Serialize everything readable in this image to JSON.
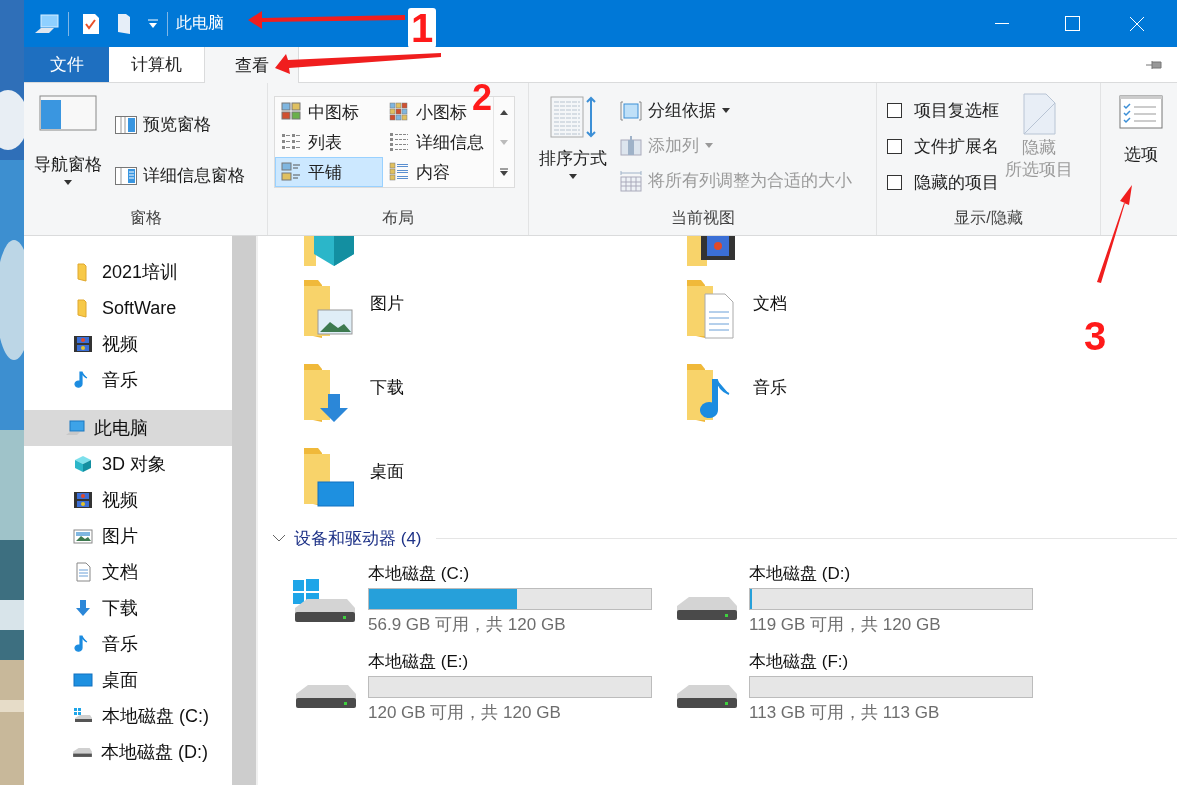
{
  "title_bar": {
    "title": "此电脑"
  },
  "tabs": [
    {
      "label": "文件",
      "kind": "file",
      "selected": false
    },
    {
      "label": "计算机",
      "kind": "tab",
      "selected": false
    },
    {
      "label": "查看",
      "kind": "tab",
      "selected": true
    }
  ],
  "ribbon": {
    "panes": {
      "label": "窗格",
      "nav_pane": "导航窗格",
      "preview_pane": "预览窗格",
      "details_pane": "详细信息窗格"
    },
    "layout": {
      "label": "布局",
      "options": [
        {
          "label": "中图标",
          "kind": "medium",
          "selected": false
        },
        {
          "label": "小图标",
          "kind": "small",
          "selected": false
        },
        {
          "label": "列表",
          "kind": "list",
          "selected": false
        },
        {
          "label": "详细信息",
          "kind": "details",
          "selected": false
        },
        {
          "label": "平铺",
          "kind": "tiles",
          "selected": true
        },
        {
          "label": "内容",
          "kind": "content",
          "selected": false
        }
      ]
    },
    "current_view": {
      "label": "当前视图",
      "sort": "排序方式",
      "commands": [
        {
          "label": "分组依据",
          "kind": "group",
          "dropdown": true,
          "disabled": false
        },
        {
          "label": "添加列",
          "kind": "column",
          "dropdown": true,
          "disabled": true
        },
        {
          "label": "将所有列调整为合适的大小",
          "kind": "fit",
          "dropdown": false,
          "disabled": true
        }
      ]
    },
    "show_hide": {
      "label": "显示/隐藏",
      "checkboxes": [
        {
          "label": "项目复选框",
          "checked": false
        },
        {
          "label": "文件扩展名",
          "checked": false
        },
        {
          "label": "隐藏的项目",
          "checked": false
        }
      ],
      "hide_selected": {
        "lines": [
          "隐藏",
          "所选项目"
        ],
        "disabled": true
      }
    },
    "options": {
      "label": "选项"
    }
  },
  "sidebar": {
    "quick_access": [
      {
        "label": "2021培训",
        "kind": "folder",
        "selected": false
      },
      {
        "label": "SoftWare",
        "kind": "folder",
        "selected": false
      },
      {
        "label": "视频",
        "kind": "video",
        "selected": false
      },
      {
        "label": "音乐",
        "kind": "music",
        "selected": false
      }
    ],
    "this_pc": {
      "label": "此电脑",
      "selected": true,
      "children": [
        {
          "label": "3D 对象",
          "kind": "cube",
          "selected": false
        },
        {
          "label": "视频",
          "kind": "video",
          "selected": false
        },
        {
          "label": "图片",
          "kind": "pictures",
          "selected": false
        },
        {
          "label": "文档",
          "kind": "documents",
          "selected": false
        },
        {
          "label": "下载",
          "kind": "downloads",
          "selected": false
        },
        {
          "label": "音乐",
          "kind": "music",
          "selected": false
        },
        {
          "label": "桌面",
          "kind": "desktop",
          "selected": false
        },
        {
          "label": "本地磁盘 (C:)",
          "kind": "system",
          "selected": false
        },
        {
          "label": "本地磁盘 (D:)",
          "kind": "drive",
          "selected": false
        }
      ]
    }
  },
  "folders": [
    {
      "label": "图片",
      "kind": "pictures"
    },
    {
      "label": "文档",
      "kind": "documents"
    },
    {
      "label": "下载",
      "kind": "downloads"
    },
    {
      "label": "音乐",
      "kind": "music"
    },
    {
      "label": "桌面",
      "kind": "desktop"
    }
  ],
  "devices": {
    "header": "设备和驱动器 (4)",
    "expanded": true,
    "drives": [
      {
        "name": "本地磁盘 (C:)",
        "kind": "system",
        "level": 0.526,
        "free": "56.9 GB 可用，共 120 GB"
      },
      {
        "name": "本地磁盘 (D:)",
        "kind": "drive",
        "level": 0.008,
        "free": "119 GB 可用，共 120 GB"
      },
      {
        "name": "本地磁盘 (E:)",
        "kind": "drive",
        "level": 0,
        "free": "120 GB 可用，共 120 GB"
      },
      {
        "name": "本地磁盘 (F:)",
        "kind": "drive",
        "level": 0,
        "free": "113 GB 可用，共 113 GB"
      }
    ]
  },
  "annotations": [
    {
      "label": "1"
    },
    {
      "label": "2"
    },
    {
      "label": "3"
    }
  ]
}
